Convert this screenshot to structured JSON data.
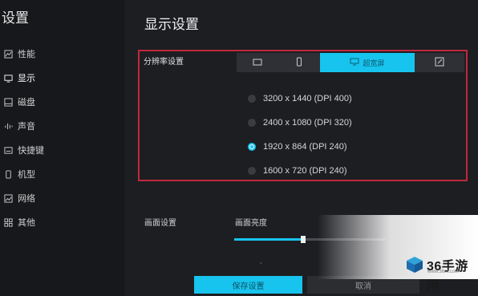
{
  "app": {
    "title": "设置"
  },
  "sidebar": {
    "items": [
      {
        "label": "性能",
        "icon": "performance-icon"
      },
      {
        "label": "显示",
        "icon": "monitor-icon",
        "active": true
      },
      {
        "label": "磁盘",
        "icon": "disk-icon"
      },
      {
        "label": "声音",
        "icon": "sound-icon"
      },
      {
        "label": "快捷键",
        "icon": "keyboard-icon"
      },
      {
        "label": "机型",
        "icon": "phone-icon"
      },
      {
        "label": "网络",
        "icon": "network-icon"
      },
      {
        "label": "其他",
        "icon": "grid-icon"
      }
    ]
  },
  "main": {
    "title": "显示设置",
    "resolution": {
      "label": "分辨率设置",
      "tabs": [
        {
          "icon": "tablet-landscape-icon",
          "label": ""
        },
        {
          "icon": "phone-portrait-icon",
          "label": ""
        },
        {
          "icon": "monitor-icon",
          "label": "超宽屏",
          "active": true
        },
        {
          "icon": "edit-icon",
          "label": ""
        }
      ],
      "options": [
        {
          "label": "3200 x 1440 (DPI 400)",
          "selected": false
        },
        {
          "label": "2400 x 1080 (DPI 320)",
          "selected": false
        },
        {
          "label": "1920 x 864 (DPI 240)",
          "selected": true
        },
        {
          "label": "1600 x 720 (DPI 240)",
          "selected": false
        }
      ]
    },
    "screen": {
      "label": "画面设置",
      "brightness_label": "画面亮度",
      "brightness_value": 0.46
    },
    "buttons": {
      "save": "保存设置",
      "cancel": "取消"
    }
  },
  "watermark": {
    "name": "36手游网",
    "url": "www.36nt.com"
  },
  "colors": {
    "accent": "#17c4ee",
    "highlight_border": "#c0283c",
    "background": "#1d1e22"
  }
}
